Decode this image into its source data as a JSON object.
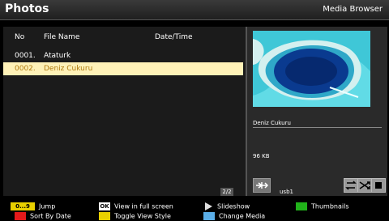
{
  "header": {
    "title": "Photos",
    "subtitle": "Media Browser"
  },
  "list": {
    "columns": {
      "no": "No",
      "file_name": "File Name",
      "date_time": "Date/Time"
    },
    "rows": [
      {
        "no": "0001.",
        "name": "Ataturk"
      },
      {
        "no": "0002.",
        "name": "Deniz Cukuru"
      }
    ],
    "page": "2/2"
  },
  "preview": {
    "file_name": "Deniz Cukuru",
    "size": "96 KB",
    "source": "usb1",
    "icons": [
      "usb-icon",
      "repeat-icon",
      "shuffle-icon",
      "stop-icon"
    ]
  },
  "legend": {
    "jump_key": "0...9",
    "jump": "Jump",
    "ok_key": "OK",
    "view_full": "View in full screen",
    "slideshow": "Slideshow",
    "thumbnails": "Thumbnails",
    "sort_by_date": "Sort By Date",
    "toggle_view_style": "Toggle View Style",
    "change_media": "Change Media"
  },
  "colors": {
    "selected_row_bg": "#fff2b8",
    "selected_row_text": "#b07b10",
    "key_yellow": "#e8d000",
    "key_green": "#21b21a",
    "key_red": "#e41a1a",
    "key_blue": "#5aaee8"
  }
}
